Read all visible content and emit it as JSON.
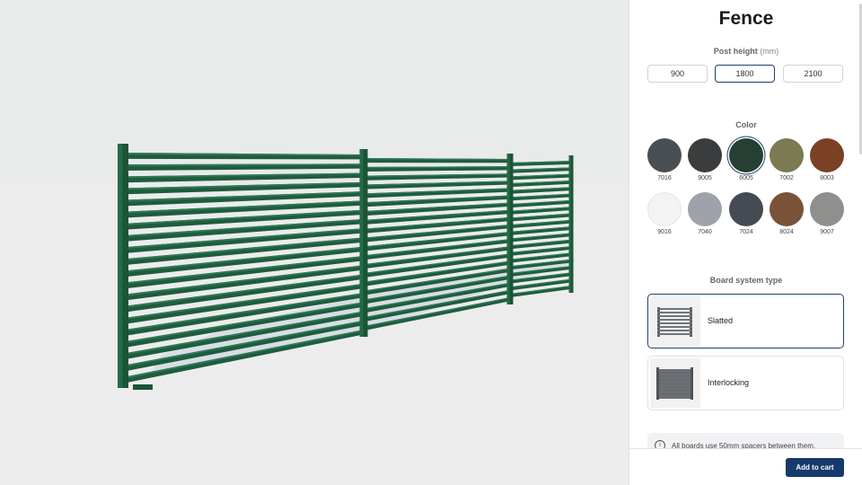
{
  "panel": {
    "title": "Fence",
    "post_height": {
      "label": "Post height",
      "unit": "(mm)",
      "options": [
        "900",
        "1800",
        "2100"
      ],
      "selected": "1800"
    },
    "color": {
      "label": "Color",
      "selected": "6005",
      "swatches": [
        {
          "code": "7016",
          "hex": "#4a4f54"
        },
        {
          "code": "9005",
          "hex": "#3b3c3d"
        },
        {
          "code": "6005",
          "hex": "#253f33"
        },
        {
          "code": "7002",
          "hex": "#7b7a52"
        },
        {
          "code": "8003",
          "hex": "#7a4125"
        },
        {
          "code": "9016",
          "hex": "#f3f3f3"
        },
        {
          "code": "7040",
          "hex": "#9ea2aa"
        },
        {
          "code": "7024",
          "hex": "#464b53"
        },
        {
          "code": "8024",
          "hex": "#7a5238"
        },
        {
          "code": "9007",
          "hex": "#8f8f8e"
        }
      ]
    },
    "board_system": {
      "label": "Board system type",
      "options": [
        {
          "label": "Slatted",
          "selected": true
        },
        {
          "label": "Interlocking",
          "selected": false
        }
      ]
    },
    "info_text": "All boards use 50mm spacers between them.",
    "add_to_cart_label": "Add to cart"
  },
  "viewport": {
    "fence_color": "#1f5c3f",
    "background": "#ececec"
  }
}
